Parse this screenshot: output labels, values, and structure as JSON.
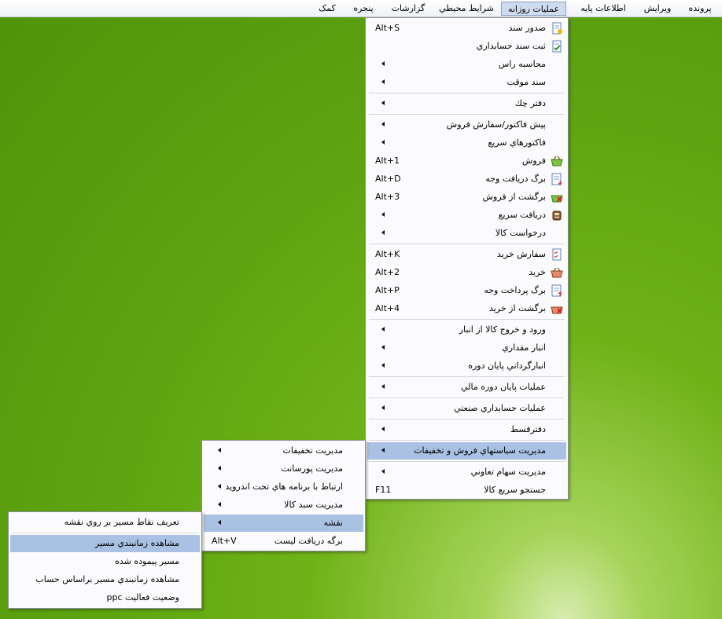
{
  "menubar": {
    "items": [
      {
        "label": "پرونده"
      },
      {
        "label": "ويرايش"
      },
      {
        "label": "اطلاعات پايه"
      },
      {
        "label": "عمليات روزانه"
      },
      {
        "label": "شرايط محيطي"
      },
      {
        "label": "گزارشات"
      },
      {
        "label": "پنجره"
      },
      {
        "label": "کمک"
      }
    ]
  },
  "main_menu": {
    "items": [
      {
        "label": "صدور سند",
        "shortcut": "Alt+S",
        "icon": "document-new-icon"
      },
      {
        "label": "ثبت سند حسابداري",
        "icon": "document-check-icon"
      },
      {
        "label": "محاسبه راس"
      },
      {
        "label": "سند موقت"
      },
      {
        "label": "دفتر چك"
      },
      {
        "label": "پيش فاكتور/سفارش فروش"
      },
      {
        "label": "فاكتورهاي سريع"
      },
      {
        "label": "فروش",
        "shortcut": "Alt+1",
        "icon": "basket-icon"
      },
      {
        "label": "برگ دريافت وجه",
        "shortcut": "Alt+D",
        "icon": "receipt-icon"
      },
      {
        "label": "برگشت از فروش",
        "shortcut": "Alt+3",
        "icon": "basket-return-icon"
      },
      {
        "label": "دريافت سريع",
        "icon": "cash-register-icon"
      },
      {
        "label": "درخواست كالا"
      },
      {
        "label": "سفارش خريد",
        "shortcut": "Alt+K",
        "icon": "checklist-icon"
      },
      {
        "label": "خريد",
        "shortcut": "Alt+2",
        "icon": "basket-purchase-icon"
      },
      {
        "label": "برگ پرداخت وجه",
        "shortcut": "Alt+P",
        "icon": "payment-slip-icon"
      },
      {
        "label": "برگشت از خريد",
        "shortcut": "Alt+4",
        "icon": "basket-purchase-return-icon"
      },
      {
        "label": "ورود و خروج كالا از انبار"
      },
      {
        "label": "انبار مقداري"
      },
      {
        "label": "انبارگرداني پايان دوره"
      },
      {
        "label": "عمليات پايان دوره مالي"
      },
      {
        "label": "عمليات حسابداري صنعتي"
      },
      {
        "label": "دفترقسط"
      },
      {
        "label": "مديريت سياستهاي فروش و تخفيفات"
      },
      {
        "label": "مديريت سهام تعاوني"
      },
      {
        "label": "جستجو سريع كالا",
        "shortcut": "F11"
      }
    ]
  },
  "sub_menu": {
    "items": [
      {
        "label": "مديريت تخفيفات"
      },
      {
        "label": "مديريت پورسانت"
      },
      {
        "label": "ارتباط با برنامه هاي تحت اندرويد"
      },
      {
        "label": "مديريت سبد كالا"
      },
      {
        "label": "نقشه"
      },
      {
        "label": "برگه دريافت ليست",
        "shortcut": "Alt+V"
      }
    ]
  },
  "map_menu": {
    "items": [
      {
        "label": "تعريف نقاط مسير بر روي نقشه"
      },
      {
        "label": "مشاهده زمانبندي مسير"
      },
      {
        "label": "مسير پيموده شده"
      },
      {
        "label": "مشاهده زمانبندي مسير براساس حساب"
      },
      {
        "label": "وضعيت فعاليت ppc"
      }
    ]
  }
}
